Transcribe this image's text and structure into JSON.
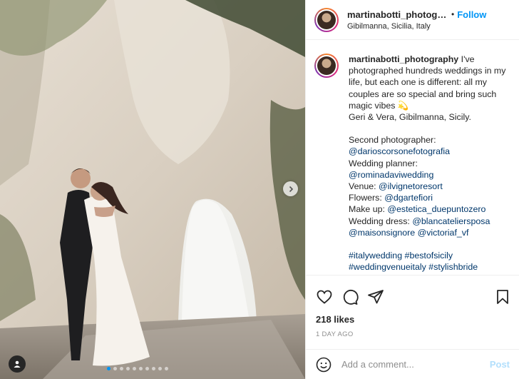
{
  "post": {
    "username": "martinabotti_photography",
    "location": "Gibilmanna, Sicilia, Italy",
    "follow_label": "Follow",
    "separator": "•",
    "caption": {
      "username": "martinabotti_photography",
      "intro": "I've photographed hundreds weddings in my life, but each one is different: all my couples are so special and bring such magic vibes 💫",
      "place_line": "Geri & Vera, Gibilmanna, Sicily.",
      "credits": [
        {
          "label": "Second photographer:",
          "mention": "@darioscorsonefotografia",
          "inline": false
        },
        {
          "label": "Wedding planner:",
          "mention": "@rominadaviwedding",
          "inline": false
        },
        {
          "label": "Venue:",
          "mention": "@ilvignetoresort",
          "inline": true
        },
        {
          "label": "Flowers:",
          "mention": "@dgartefiori",
          "inline": true
        },
        {
          "label": "Make up:",
          "mention": "@estetica_duepuntozero",
          "inline": true
        },
        {
          "label": "Wedding dress:",
          "mention": "@blancateliersposa",
          "inline": true
        }
      ],
      "extra_mentions": [
        "@maisonsignore",
        "@victoriaf_vf"
      ],
      "hashtags_line1": [
        "#italywedding",
        "#bestofsicily"
      ],
      "hashtags_line2": [
        "#weddingvenueitaly",
        "#stylishbride"
      ]
    },
    "likes": "218 likes",
    "date": "1 DAY AGO",
    "comment_placeholder": "Add a comment...",
    "post_label": "Post",
    "carousel": {
      "total_slides": 10,
      "active_index": 0
    },
    "colors": {
      "follow": "#0095f6",
      "mention": "#00376b",
      "post_disabled": "#b2dffc",
      "muted": "#8e8e8e"
    },
    "icons": [
      "heart-icon",
      "comment-icon",
      "share-icon",
      "bookmark-icon",
      "emoji-icon",
      "chevron-right-icon",
      "user-tag-icon"
    ]
  }
}
